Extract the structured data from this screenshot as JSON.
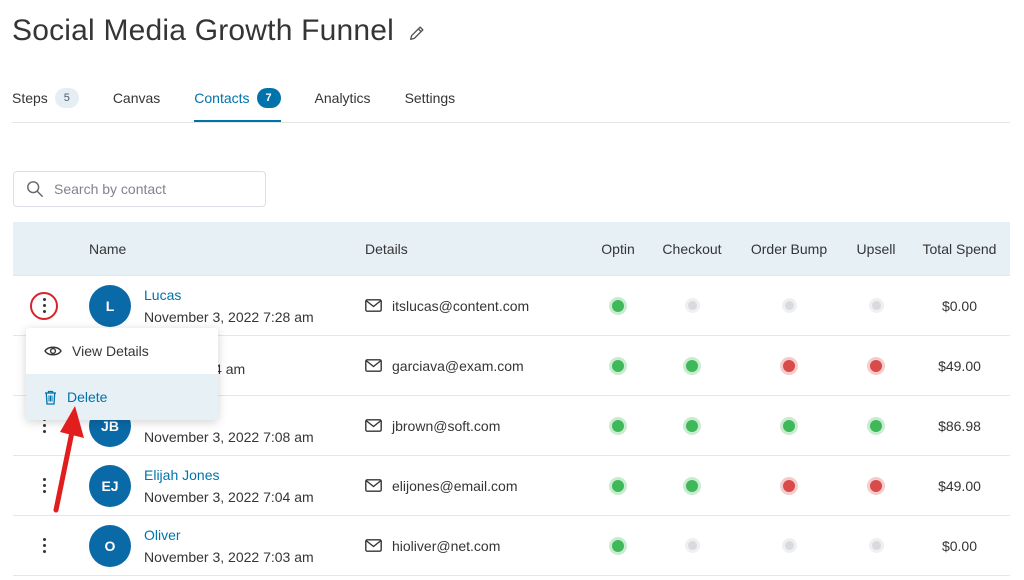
{
  "header": {
    "title": "Social Media Growth Funnel",
    "edit_icon": "pencil-icon"
  },
  "tabs": [
    {
      "label": "Steps",
      "count": "5",
      "active": false
    },
    {
      "label": "Canvas",
      "count": null,
      "active": false
    },
    {
      "label": "Contacts",
      "count": "7",
      "active": true
    },
    {
      "label": "Analytics",
      "count": null,
      "active": false
    },
    {
      "label": "Settings",
      "count": null,
      "active": false
    }
  ],
  "search": {
    "placeholder": "Search by contact",
    "value": ""
  },
  "table": {
    "columns": [
      "Name",
      "Details",
      "Optin",
      "Checkout",
      "Order Bump",
      "Upsell",
      "Total Spend"
    ],
    "rows": [
      {
        "initials": "L",
        "name": "Lucas",
        "date": "November 3, 2022 7:28 am",
        "email": "itslucas@content.com",
        "optin": "green",
        "checkout": "gray",
        "bump": "gray",
        "upsell": "gray",
        "total": "$0.00"
      },
      {
        "initials": "",
        "name": "",
        "date": "3, 2022 7:14 am",
        "email": "garciava@exam.com",
        "optin": "green",
        "checkout": "green",
        "bump": "red",
        "upsell": "red",
        "total": "$49.00"
      },
      {
        "initials": "JB",
        "name": "n",
        "date": "November 3, 2022 7:08 am",
        "email": "jbrown@soft.com",
        "optin": "green",
        "checkout": "green",
        "bump": "green",
        "upsell": "green",
        "total": "$86.98"
      },
      {
        "initials": "EJ",
        "name": "Elijah Jones",
        "date": "November 3, 2022 7:04 am",
        "email": "elijones@email.com",
        "optin": "green",
        "checkout": "green",
        "bump": "red",
        "upsell": "red",
        "total": "$49.00"
      },
      {
        "initials": "O",
        "name": "Oliver",
        "date": "November 3, 2022 7:03 am",
        "email": "hioliver@net.com",
        "optin": "green",
        "checkout": "gray",
        "bump": "gray",
        "upsell": "gray",
        "total": "$0.00"
      }
    ]
  },
  "row_menu": {
    "view_label": "View Details",
    "view_icon": "eye-icon",
    "delete_label": "Delete",
    "delete_icon": "trash-icon"
  },
  "colors": {
    "accent": "#0073aa",
    "avatar": "#0a6aa7",
    "highlight": "#d8232a",
    "header_bg": "#e7f0f5"
  }
}
